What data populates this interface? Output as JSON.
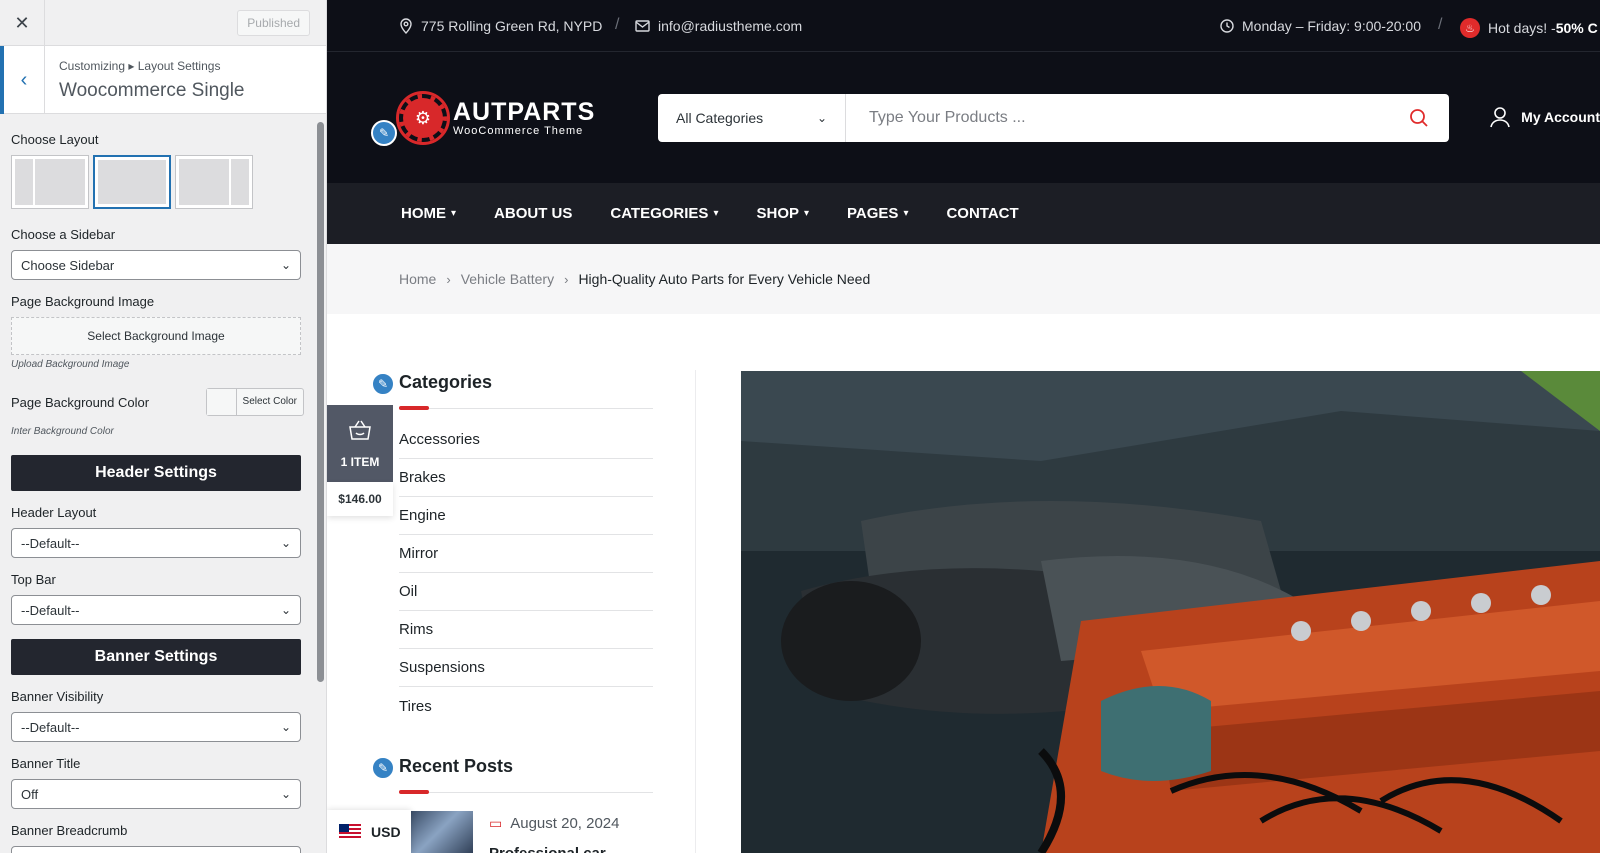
{
  "customizer": {
    "published_label": "Published",
    "breadcrumb": "Customizing ▸ Layout Settings",
    "title": "Woocommerce Single",
    "choose_layout_label": "Choose Layout",
    "choose_sidebar_label": "Choose a Sidebar",
    "choose_sidebar_value": "Choose Sidebar",
    "bg_image_label": "Page Background Image",
    "bg_image_button": "Select Background Image",
    "bg_image_note": "Upload Background Image",
    "bg_color_label": "Page Background Color",
    "bg_color_button": "Select Color",
    "bg_color_note": "Inter Background Color",
    "header_settings": "Header Settings",
    "header_layout_label": "Header Layout",
    "header_layout_value": "--Default--",
    "top_bar_label": "Top Bar",
    "top_bar_value": "--Default--",
    "banner_settings": "Banner Settings",
    "banner_visibility_label": "Banner Visibility",
    "banner_visibility_value": "--Default--",
    "banner_title_label": "Banner Title",
    "banner_title_value": "Off",
    "banner_breadcrumb_label": "Banner Breadcrumb"
  },
  "topbar": {
    "address": "775 Rolling Green Rd, NYPD",
    "email": "info@radiustheme.com",
    "hours": "Monday – Friday: 9:00-20:00",
    "hot_prefix": "Hot days! - ",
    "hot_value": "50% C"
  },
  "header": {
    "logo_title": "AUTPARTS",
    "logo_subtitle": "WooCommerce Theme",
    "search_category": "All Categories",
    "search_placeholder": "Type Your Products ...",
    "account_label": "My Account"
  },
  "nav": [
    "HOME",
    "ABOUT US",
    "CATEGORIES",
    "SHOP",
    "PAGES",
    "CONTACT"
  ],
  "breadcrumb": {
    "home": "Home",
    "category": "Vehicle Battery",
    "current": "High-Quality Auto Parts for Every Vehicle Need"
  },
  "cart": {
    "count": "1 ITEM",
    "total": "$146.00"
  },
  "categories_widget": {
    "title": "Categories",
    "items": [
      "Accessories",
      "Brakes",
      "Engine",
      "Mirror",
      "Oil",
      "Rims",
      "Suspensions",
      "Tires"
    ]
  },
  "recent_posts": {
    "title": "Recent Posts",
    "date": "August 20, 2024",
    "post_title": "Professional car"
  },
  "currency": {
    "code": "USD"
  },
  "colors": {
    "dark_header": "#0d0f17",
    "nav_bg": "#1c1e25",
    "accent_red": "#d8282a",
    "wp_blue": "#2271b1"
  },
  "icons": {
    "close": "close-icon",
    "back": "chevron-left-icon",
    "location": "map-pin-icon",
    "email": "envelope-icon",
    "clock": "clock-icon",
    "fire": "fire-icon",
    "search": "search-icon",
    "account": "user-icon",
    "basket": "basket-icon",
    "calendar": "calendar-icon",
    "edit": "pencil-icon"
  }
}
